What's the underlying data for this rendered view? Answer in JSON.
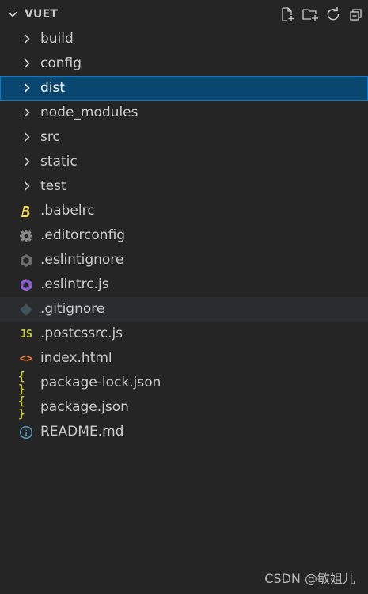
{
  "explorer": {
    "title": "VUET",
    "actions": [
      {
        "name": "new-file-icon"
      },
      {
        "name": "new-folder-icon"
      },
      {
        "name": "refresh-icon"
      },
      {
        "name": "collapse-all-icon"
      }
    ]
  },
  "items": [
    {
      "type": "folder",
      "label": "build"
    },
    {
      "type": "folder",
      "label": "config"
    },
    {
      "type": "folder",
      "label": "dist",
      "selected": true
    },
    {
      "type": "folder",
      "label": "node_modules"
    },
    {
      "type": "folder",
      "label": "src"
    },
    {
      "type": "folder",
      "label": "static"
    },
    {
      "type": "folder",
      "label": "test"
    },
    {
      "type": "file",
      "label": ".babelrc",
      "icon": "babel-icon",
      "icon_color": "#f5da55"
    },
    {
      "type": "file",
      "label": ".editorconfig",
      "icon": "gear-icon",
      "icon_color": "#8a8a8a"
    },
    {
      "type": "file",
      "label": ".eslintignore",
      "icon": "eslint-icon",
      "icon_color": "#6d6d6d"
    },
    {
      "type": "file",
      "label": ".eslintrc.js",
      "icon": "eslint-icon",
      "icon_color": "#8e5fd0"
    },
    {
      "type": "file",
      "label": ".gitignore",
      "icon": "git-icon",
      "icon_color": "#41535b",
      "hover": true
    },
    {
      "type": "file",
      "label": ".postcssrc.js",
      "icon": "js-icon",
      "icon_color": "#cbcb41",
      "icon_text": "JS"
    },
    {
      "type": "file",
      "label": "index.html",
      "icon": "html-icon",
      "icon_color": "#e37933",
      "icon_text": "<>"
    },
    {
      "type": "file",
      "label": "package-lock.json",
      "icon": "json-icon",
      "icon_color": "#cbcb41",
      "icon_text": "{ }"
    },
    {
      "type": "file",
      "label": "package.json",
      "icon": "json-icon",
      "icon_color": "#cbcb41",
      "icon_text": "{ }"
    },
    {
      "type": "file",
      "label": "README.md",
      "icon": "info-icon",
      "icon_color": "#519aba",
      "icon_text": "i"
    }
  ],
  "watermark": "CSDN @敏姐儿"
}
